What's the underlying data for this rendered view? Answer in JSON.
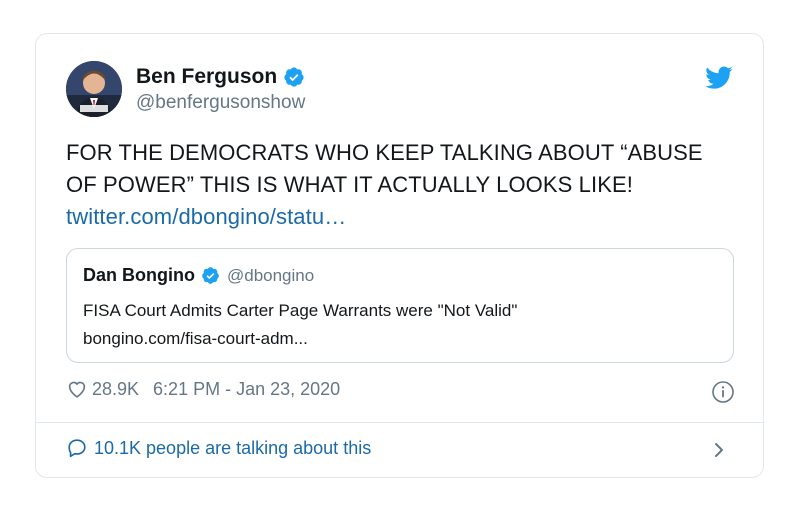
{
  "tweet": {
    "author": {
      "name": "Ben Ferguson",
      "handle": "@benfergusonshow",
      "avatar_icon": "person-avatar",
      "verified": true
    },
    "text": "FOR THE DEMOCRATS WHO KEEP TALKING ABOUT “ABUSE OF POWER” THIS IS WHAT IT ACTUALLY LOOKS LIKE! ",
    "link": "twitter.com/dbongino/statu…",
    "quoted": {
      "name": "Dan Bongino",
      "handle": "@dbongino",
      "verified": true,
      "text": "FISA Court Admits Carter Page Warrants were \"Not Valid\"",
      "link": "bongino.com/fisa-court-adm..."
    },
    "likes": "28.9K",
    "timestamp": "6:21 PM - Jan 23, 2020",
    "conversation": "10.1K people are talking about this"
  },
  "icons": {
    "brand": "twitter-bird-icon",
    "like": "heart-icon",
    "info": "info-icon",
    "comment": "comment-icon",
    "chevron": "chevron-right-icon",
    "verified": "verified-badge-icon"
  },
  "colors": {
    "brand_blue": "#1da1f2",
    "link_blue": "#1b6aa7",
    "muted": "#657786",
    "border": "#e1e8ed"
  }
}
